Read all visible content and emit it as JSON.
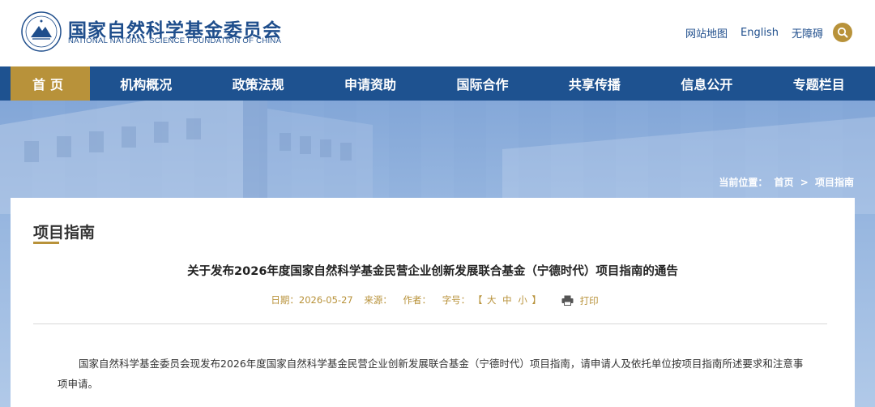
{
  "header": {
    "site_name_cn": "国家自然科学基金委员会",
    "site_name_en": "NATIONAL NATURAL SCIENCE FOUNDATION OF CHINA",
    "links": [
      "网站地图",
      "English",
      "无障碍"
    ],
    "search_icon": "search-icon",
    "accent_color": "#b8923a",
    "brand_color": "#1f4e8c"
  },
  "nav": {
    "items": [
      "首页",
      "机构概况",
      "政策法规",
      "申请资助",
      "国际合作",
      "共享传播",
      "信息公开",
      "专题栏目"
    ],
    "active_index": 0,
    "background": "#1e5290"
  },
  "breadcrumb": {
    "label": "当前位置：",
    "items": [
      "首页",
      "项目指南"
    ],
    "separator": ">"
  },
  "section": {
    "title": "项目指南"
  },
  "article": {
    "title": "关于发布2026年度国家自然科学基金民营企业创新发展联合基金（宁德时代）项目指南的通告",
    "meta": {
      "date": "日期：2026-05-27",
      "source": "来源：",
      "author": "作者：",
      "font_size_label": "字号：",
      "open_bracket": "【",
      "size_large": "大",
      "size_medium": "中",
      "size_small": "小",
      "close_bracket": "】",
      "print_label": "打印"
    },
    "body": "国家自然科学基金委员会现发布2026年度国家自然科学基金民营企业创新发展联合基金（宁德时代）项目指南，请申请人及依托单位按项目指南所述要求和注意事项申请。"
  }
}
